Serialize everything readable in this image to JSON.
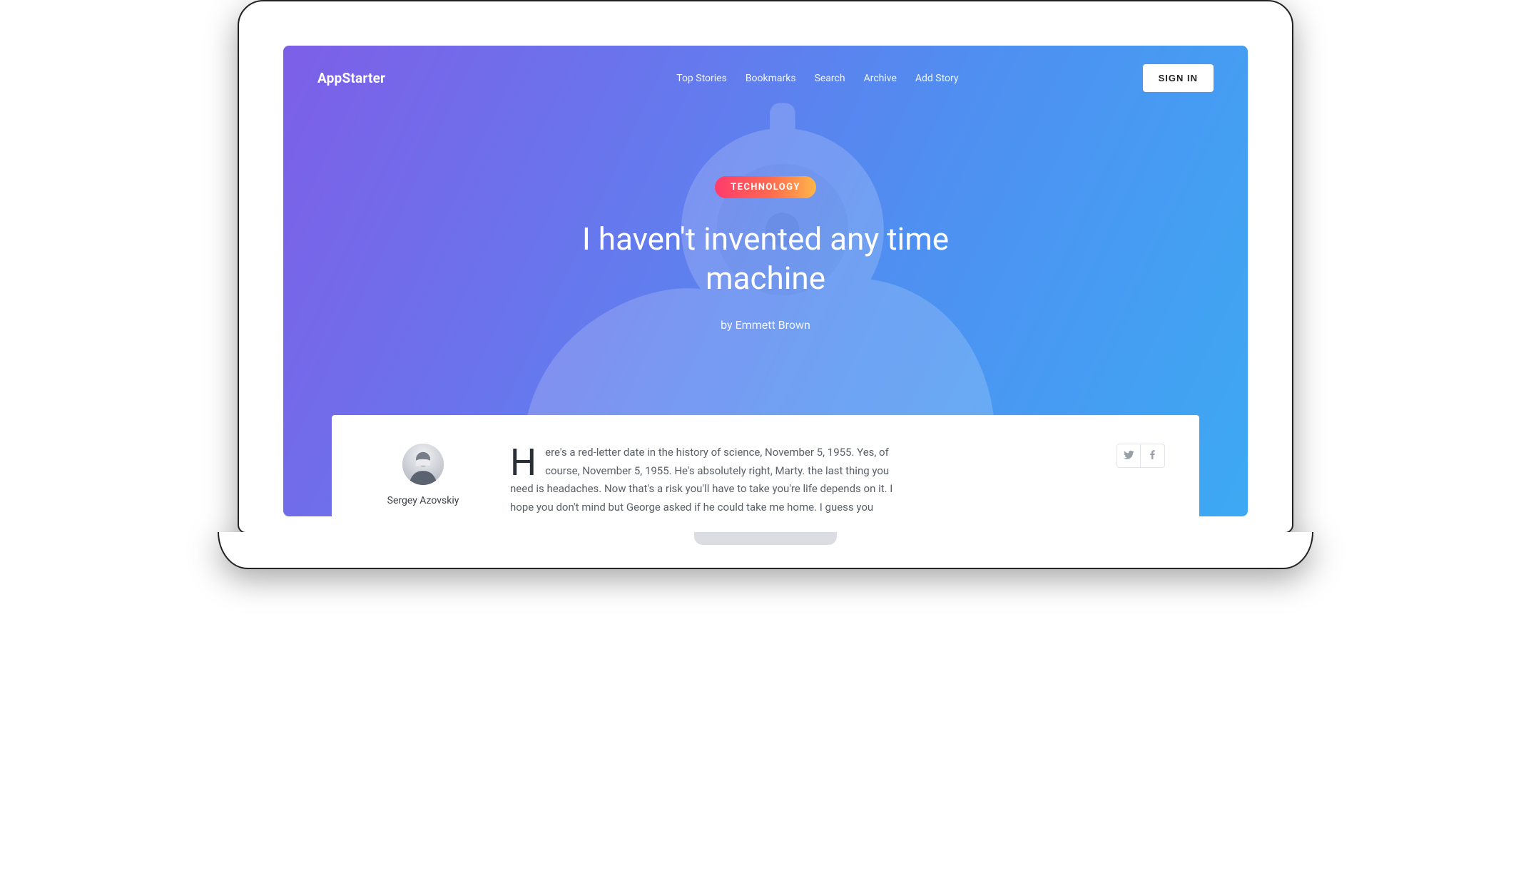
{
  "brand": "AppStarter",
  "nav": {
    "items": [
      {
        "label": "Top Stories"
      },
      {
        "label": "Bookmarks"
      },
      {
        "label": "Search"
      },
      {
        "label": "Archive"
      },
      {
        "label": "Add Story"
      }
    ],
    "signin": "SIGN IN"
  },
  "hero": {
    "tag": "TECHNOLOGY",
    "title": "I haven't invented any time machine",
    "byline": "by Emmett Brown"
  },
  "article": {
    "author": "Sergey Azovskiy",
    "dropcap": "H",
    "body": "ere's a red-letter date in the history of science, November 5, 1955. Yes, of course, November 5, 1955. He's absolutely right, Marty. the last thing you need is headaches. Now that's a risk you'll have to take you're life depends on it. I hope you don't mind but George asked if he could take me home. I guess you"
  },
  "share": {
    "twitter": "twitter-icon",
    "facebook": "facebook-icon"
  },
  "colors": {
    "gradient_start": "#7d5fe7",
    "gradient_end": "#3da9f3",
    "pill_start": "#ff3b6e",
    "pill_end": "#ffb54a"
  }
}
